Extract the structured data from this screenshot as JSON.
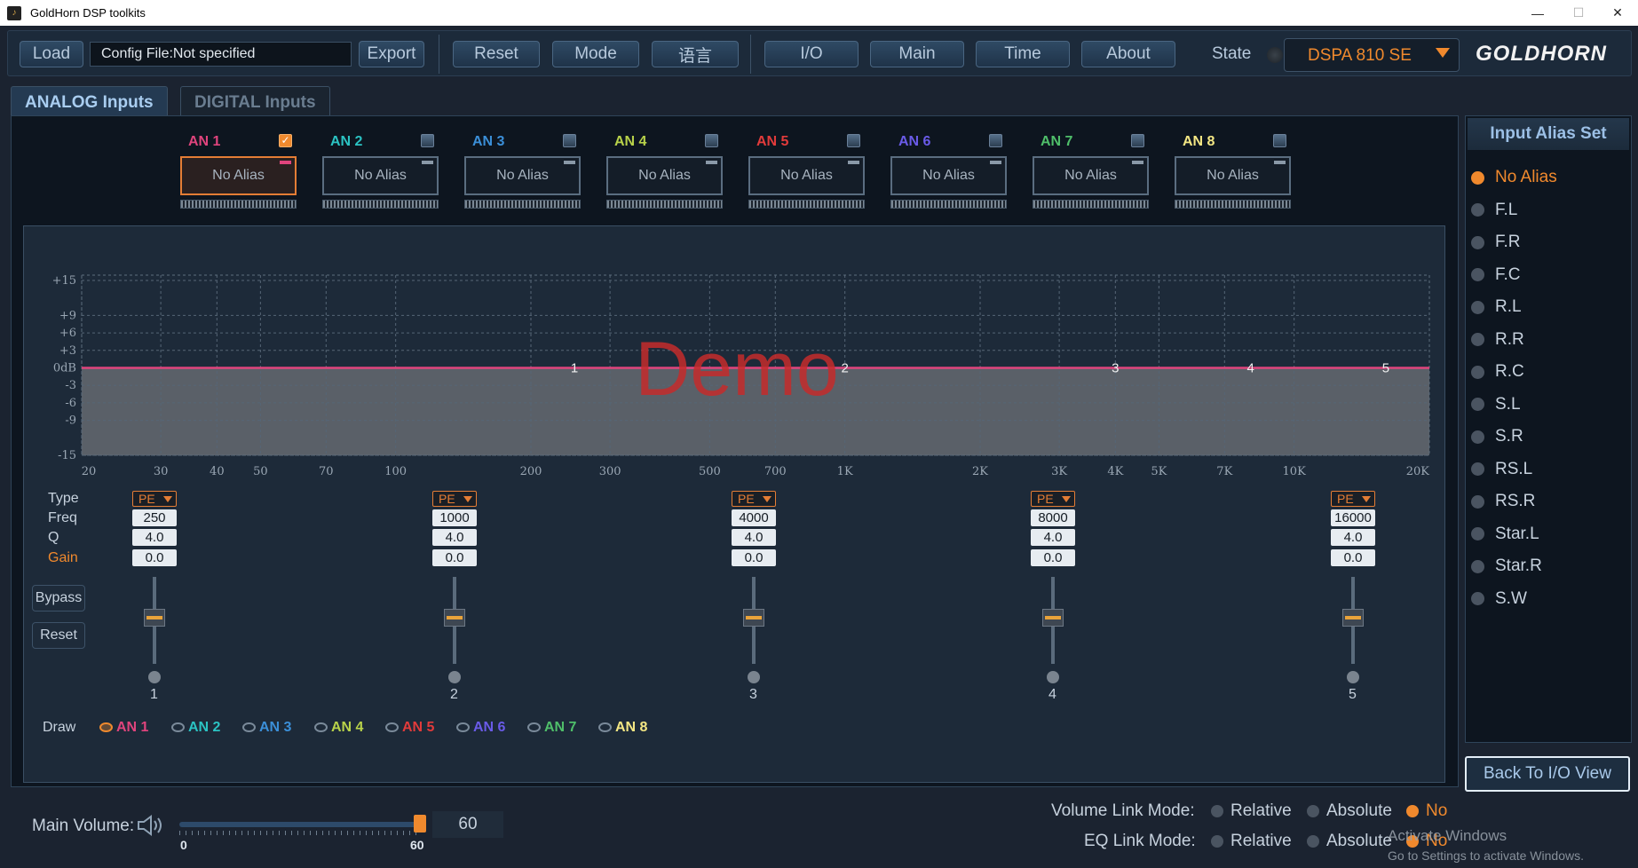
{
  "window": {
    "title": "GoldHorn DSP toolkits",
    "minimize": "—",
    "maximize": "☐",
    "close": "✕"
  },
  "toolbar": {
    "load": "Load",
    "config_file": "Config File:Not specified",
    "export": "Export",
    "reset": "Reset",
    "mode": "Mode",
    "language": "语言",
    "io": "I/O",
    "main": "Main",
    "time": "Time",
    "about": "About",
    "state_label": "State",
    "model": "DSPA 810 SE",
    "logo": "GOLDHORN"
  },
  "tabs": [
    {
      "label": "ANALOG Inputs",
      "active": true
    },
    {
      "label": "DIGITAL Inputs",
      "active": false
    }
  ],
  "channels": [
    {
      "label": "AN 1",
      "alias": "No Alias",
      "checked": true,
      "color": "#e0447d"
    },
    {
      "label": "AN 2",
      "alias": "No Alias",
      "checked": false,
      "color": "#2bc3c3"
    },
    {
      "label": "AN 3",
      "alias": "No Alias",
      "checked": false,
      "color": "#3b8fd8"
    },
    {
      "label": "AN 4",
      "alias": "No Alias",
      "checked": false,
      "color": "#b8d24a"
    },
    {
      "label": "AN 5",
      "alias": "No Alias",
      "checked": false,
      "color": "#e23b3b"
    },
    {
      "label": "AN 6",
      "alias": "No Alias",
      "checked": false,
      "color": "#6a5be8"
    },
    {
      "label": "AN 7",
      "alias": "No Alias",
      "checked": false,
      "color": "#4fbf6a"
    },
    {
      "label": "AN 8",
      "alias": "No Alias",
      "checked": false,
      "color": "#f4e784"
    }
  ],
  "graph": {
    "watermark": "Demo",
    "y_ticks": [
      "+15",
      "+9",
      "+6",
      "+3",
      "0dB",
      "-3",
      "-6",
      "-9",
      "-15"
    ],
    "x_ticks": [
      "20",
      "30",
      "40",
      "50",
      "70",
      "100",
      "200",
      "300",
      "500",
      "700",
      "1K",
      "2K",
      "3K",
      "4K",
      "5K",
      "7K",
      "10K",
      "20K"
    ],
    "band_markers": [
      "1",
      "2",
      "3",
      "4",
      "5"
    ]
  },
  "controls": {
    "type_label": "Type",
    "freq_label": "Freq",
    "q_label": "Q",
    "gain_label": "Gain",
    "bypass": "Bypass",
    "reset": "Reset",
    "draw_label": "Draw"
  },
  "bands": [
    {
      "num": "1",
      "type": "PE",
      "freq": "250",
      "q": "4.0",
      "gain": "0.0"
    },
    {
      "num": "2",
      "type": "PE",
      "freq": "1000",
      "q": "4.0",
      "gain": "0.0"
    },
    {
      "num": "3",
      "type": "PE",
      "freq": "4000",
      "q": "4.0",
      "gain": "0.0"
    },
    {
      "num": "4",
      "type": "PE",
      "freq": "8000",
      "q": "4.0",
      "gain": "0.0"
    },
    {
      "num": "5",
      "type": "PE",
      "freq": "16000",
      "q": "4.0",
      "gain": "0.0"
    }
  ],
  "alias_panel": {
    "title": "Input Alias Set",
    "items": [
      "No Alias",
      "F.L",
      "F.R",
      "F.C",
      "R.L",
      "R.R",
      "R.C",
      "S.L",
      "S.R",
      "RS.L",
      "RS.R",
      "Star.L",
      "Star.R",
      "S.W"
    ],
    "selected": "No Alias",
    "back": "Back To I/O View"
  },
  "volume": {
    "label": "Main Volume:",
    "value": "60",
    "min": "0",
    "max": "60",
    "fraction": 0.97
  },
  "links": {
    "volume_label": "Volume Link Mode:",
    "eq_label": "EQ Link Mode:",
    "relative": "Relative",
    "absolute": "Absolute",
    "no": "No"
  },
  "activation": {
    "line1": "Activate Windows",
    "line2": "Go to Settings to activate Windows."
  }
}
